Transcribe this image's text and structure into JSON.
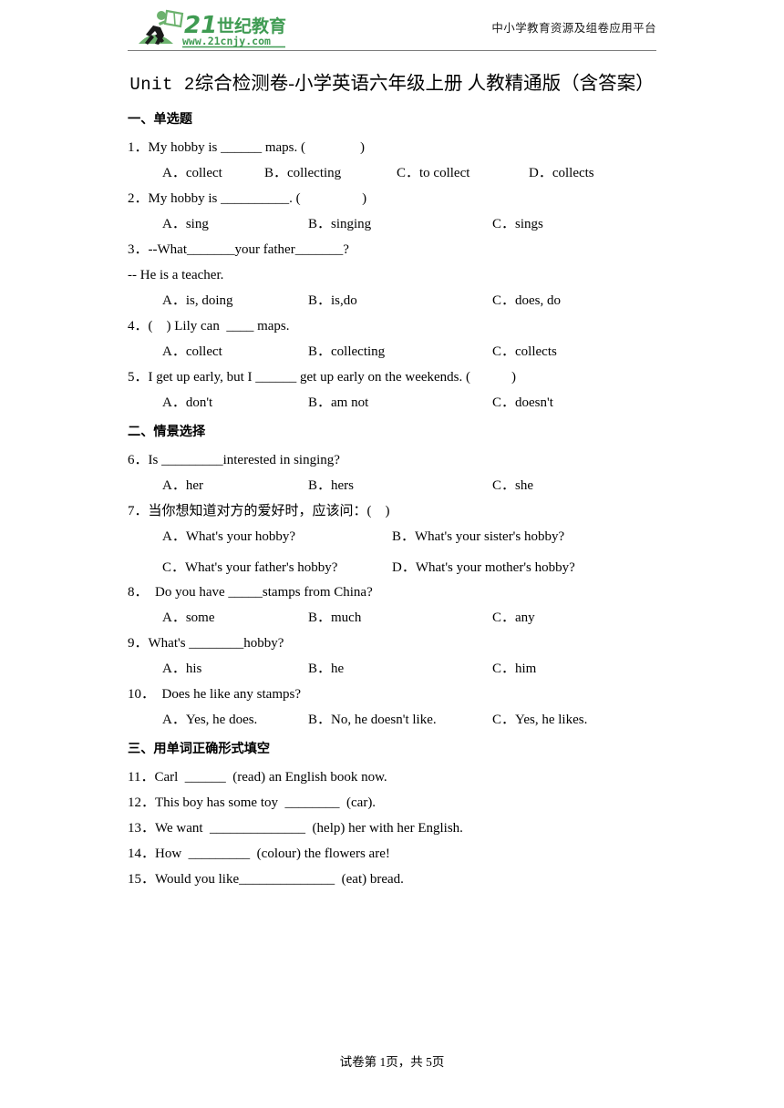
{
  "header": {
    "logo_text": "21世纪教育",
    "logo_url": "www.21cnjy.com",
    "tagline": "中小学教育资源及组卷应用平台",
    "brand_color": "#3f9b52",
    "brand_dark": "#2e7d3f"
  },
  "title": {
    "english_part": "Unit 2",
    "full": "Unit 2综合检测卷-小学英语六年级上册 人教精通版（含答案）",
    "chinese_line1": "综合检测卷-小学英语六年级上册 人教精通版（含答",
    "chinese_line2": "案）"
  },
  "sections": [
    {
      "label": "一、单选题"
    },
    {
      "label": "二、情景选择"
    },
    {
      "label": "三、用单词正确形式填空"
    }
  ],
  "questions": [
    {
      "number": "1．",
      "text": "My hobby is ______ maps. (                )",
      "layout": "cols4",
      "options": [
        "A．collect",
        "B．collecting",
        "C．to collect",
        "D．collects"
      ]
    },
    {
      "number": "2．",
      "text": "My hobby is __________. (                  )",
      "layout": "cols3",
      "options": [
        "A．sing",
        "B．singing",
        "C．sings"
      ]
    },
    {
      "number": "3．",
      "text": "--What_______your father_______?",
      "subline": "-- He is a teacher.",
      "layout": "cols3",
      "options": [
        "A．is, doing",
        "B．is,do",
        "C．does, do"
      ]
    },
    {
      "number": "4．",
      "text": "(    ) Lily can  ____ maps.",
      "layout": "cols3",
      "options": [
        "A．collect",
        "B．collecting",
        "C．collects"
      ]
    },
    {
      "number": "5．",
      "text": "I get up early, but I ______ get up early on the weekends. (            )",
      "layout": "cols3",
      "options": [
        "A．don't",
        "B．am not",
        "C．doesn't"
      ]
    },
    {
      "number": "6．",
      "text": "Is _________interested in singing?",
      "layout": "cols3",
      "options": [
        "A．her",
        "B．hers",
        "C．she"
      ]
    },
    {
      "number": "7．",
      "text": "当你想知道对方的爱好时，应该问：(    )",
      "layout": "grid2",
      "options": [
        "A．What's your hobby?",
        "B．What's your sister's hobby?",
        "C．What's your father's hobby?",
        "D．What's your mother's hobby?"
      ]
    },
    {
      "number": "8．",
      "text": "  Do you have _____stamps from China?",
      "layout": "cols3",
      "options": [
        "A．some",
        "B．much",
        "C．any"
      ]
    },
    {
      "number": "9．",
      "text": "What's ________hobby?",
      "layout": "cols3",
      "options": [
        "A．his",
        "B．he",
        "C．him"
      ]
    },
    {
      "number": "10．",
      "text": "  Does he like any stamps?",
      "layout": "cols3",
      "options": [
        "A．Yes, he does.",
        "B．No, he doesn't like.",
        "C．Yes, he likes."
      ]
    },
    {
      "number": "11．",
      "text": "Carl  ______  (read) an English book now.",
      "layout": "none",
      "options": []
    },
    {
      "number": "12．",
      "text": "This boy has some toy  ________  (car).",
      "layout": "none",
      "options": []
    },
    {
      "number": "13．",
      "text": "We want  ______________  (help) her with her English.",
      "layout": "none",
      "options": []
    },
    {
      "number": "14．",
      "text": "How  _________  (colour) the flowers are!",
      "layout": "none",
      "options": []
    },
    {
      "number": "15．",
      "text": "Would you like______________  (eat) bread.",
      "layout": "none",
      "options": []
    }
  ],
  "footer": {
    "text": "试卷第 1页，共 5页"
  }
}
